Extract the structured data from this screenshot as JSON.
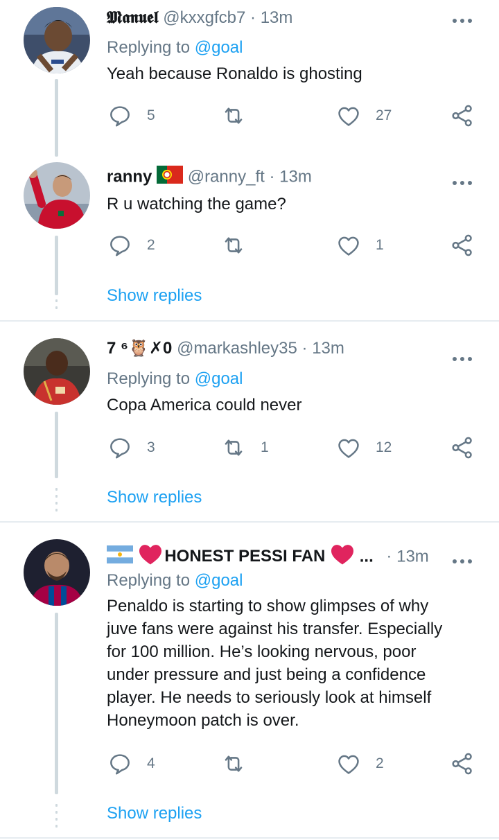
{
  "tweets": [
    {
      "name": "𝕸𝖆𝖓𝖚𝖊𝖑",
      "handle": "@kxxgfcb7",
      "sep": "·",
      "time": "13m",
      "replying_prefix": "Replying to",
      "replying_to": "@goal",
      "text": "Yeah because Ronaldo is ghosting",
      "replies": "5",
      "retweets": "",
      "likes": "27"
    },
    {
      "name": "ranny",
      "handle": "@ranny_ft",
      "sep": "·",
      "time": "13m",
      "text": "R u watching the game?",
      "replies": "2",
      "retweets": "",
      "likes": "1",
      "show_replies": "Show replies"
    },
    {
      "name": "7 ⁶🦉✗0",
      "handle": "@markashley35",
      "sep": "·",
      "time": "13m",
      "replying_prefix": "Replying to",
      "replying_to": "@goal",
      "text": "Copa America could never",
      "replies": "3",
      "retweets": "1",
      "likes": "12",
      "show_replies": "Show replies"
    },
    {
      "name": "HONEST PESSI FAN",
      "name_suffix": "...",
      "sep": "·",
      "time": "13m",
      "replying_prefix": "Replying to",
      "replying_to": "@goal",
      "text_lines": [
        "Penaldo is starting to show glimpses of why",
        "juve fans were against his transfer. Especially",
        "for 100 million. He’s looking nervous, poor",
        "under pressure and just being a confidence",
        "player. He needs to seriously look at himself",
        "Honeymoon patch is over."
      ],
      "replies": "4",
      "retweets": "",
      "likes": "2",
      "show_replies": "Show replies"
    }
  ],
  "icons": {
    "more": "more-icon",
    "reply": "reply-icon",
    "retweet": "retweet-icon",
    "like": "like-icon",
    "share": "share-icon"
  },
  "colors": {
    "link": "#1da1f2",
    "secondary": "#657786",
    "heart": "#e0245e"
  }
}
